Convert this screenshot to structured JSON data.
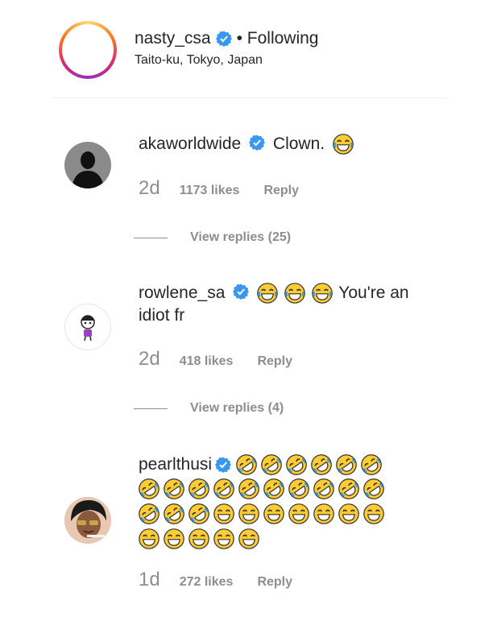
{
  "header": {
    "username": "nasty_csa",
    "separator": "•",
    "following_label": "Following",
    "location": "Taito-ku, Tokyo, Japan"
  },
  "comments": [
    {
      "username": "akaworldwide",
      "verified": true,
      "text": "Clown.",
      "time": "2d",
      "likes": "1173 likes",
      "reply_label": "Reply",
      "view_replies": "View replies (25)"
    },
    {
      "username": "rowlene_sa",
      "verified": true,
      "text_line1": "You're an",
      "text_line2": "idiot fr",
      "time": "2d",
      "likes": "418 likes",
      "reply_label": "Reply",
      "view_replies": "View replies (4)"
    },
    {
      "username": "pearlthusi",
      "verified": true,
      "time": "1d",
      "likes": "272 likes",
      "reply_label": "Reply"
    }
  ],
  "colors": {
    "verified_blue": "#3897f0",
    "emoji_yellow": "#ffcc33",
    "muted_gray": "#8e8e8e"
  },
  "icons": [
    "verified-badge-icon",
    "joy-emoji-icon",
    "rofl-emoji-icon",
    "grinning-sweat-emoji-icon"
  ]
}
